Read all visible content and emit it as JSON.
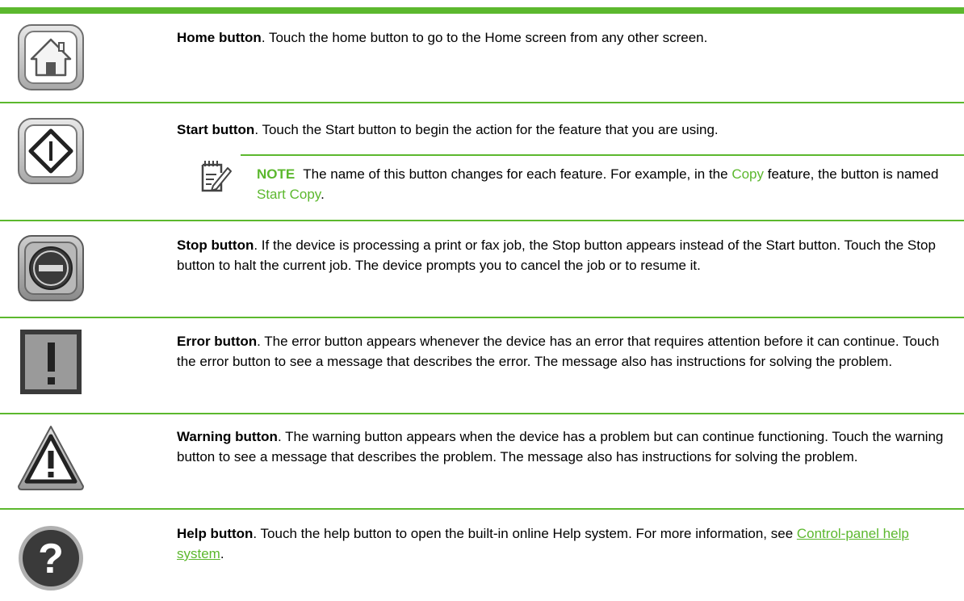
{
  "colors": {
    "accent": "#5cb82e",
    "icon_gray": "#9a9a9a",
    "icon_dark": "#3a3a3a"
  },
  "rows": [
    {
      "icon": "home-icon",
      "title": "Home button",
      "desc": ". Touch the home button to go to the Home screen from any other screen."
    },
    {
      "icon": "start-icon",
      "title": "Start button",
      "desc": ". Touch the Start button to begin the action for the feature that you are using.",
      "note": {
        "icon": "note-pencil-icon",
        "label": "NOTE",
        "part1": "The name of this button changes for each feature. For example, in the ",
        "link1": "Copy",
        "part2": " feature, the button is named ",
        "link2": "Start Copy",
        "part3": "."
      }
    },
    {
      "icon": "stop-icon",
      "title": "Stop button",
      "desc": ". If the device is processing a print or fax job, the Stop button appears instead of the Start button. Touch the Stop button to halt the current job. The device prompts you to cancel the job or to resume it."
    },
    {
      "icon": "error-icon",
      "title": "Error button",
      "desc": ". The error button appears whenever the device has an error that requires attention before it can continue. Touch the error button to see a message that describes the error. The message also has instructions for solving the problem."
    },
    {
      "icon": "warning-icon",
      "title": "Warning button",
      "desc": ". The warning button appears when the device has a problem but can continue functioning. Touch the warning button to see a message that describes the problem. The message also has instructions for solving the problem."
    },
    {
      "icon": "help-icon",
      "title": "Help button",
      "desc": ". Touch the help button to open the built-in online Help system. For more information, see ",
      "link": "Control-panel help system",
      "after": "."
    }
  ]
}
